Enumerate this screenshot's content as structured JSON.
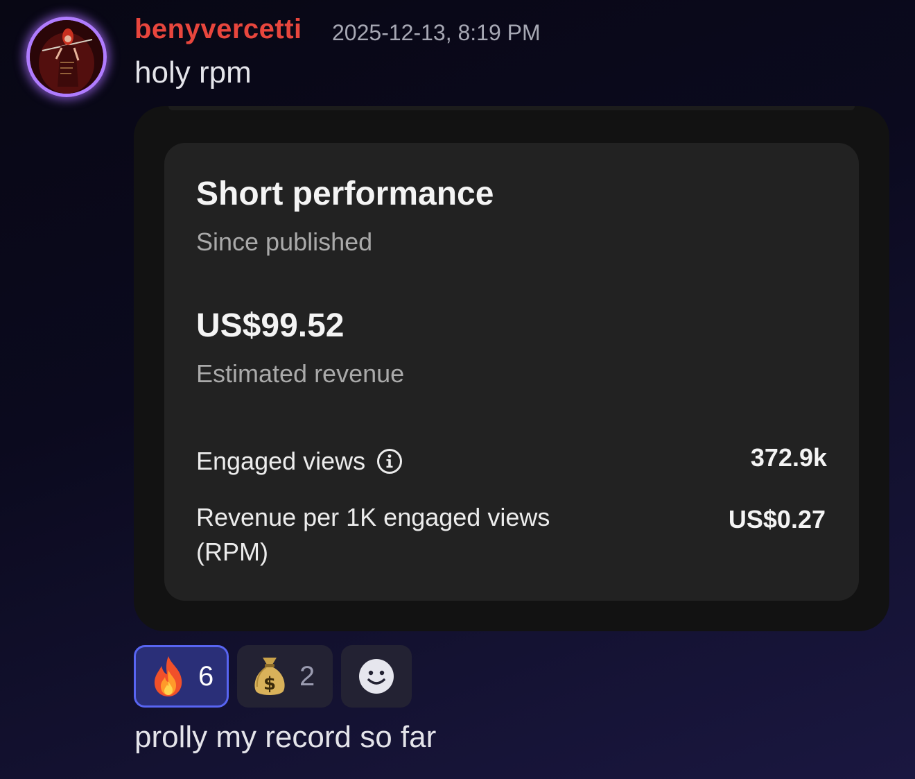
{
  "message": {
    "author": "benyvercetti",
    "timestamp": "2025-12-13, 8:19 PM",
    "text": "holy rpm",
    "author_color": "#e8463d",
    "avatar_icon": "user-avatar"
  },
  "attachment": {
    "card": {
      "title": "Short performance",
      "subtitle": "Since published",
      "revenue": {
        "value": "US$99.52",
        "label": "Estimated revenue"
      },
      "stats": [
        {
          "label": "Engaged views",
          "value": "372.9k",
          "icon": "info-icon"
        },
        {
          "label": "Revenue per 1K engaged views (RPM)",
          "value": "US$0.27"
        }
      ]
    }
  },
  "reactions": [
    {
      "emoji": "fire-emoji",
      "count": "6",
      "active": true
    },
    {
      "emoji": "money-bag-emoji",
      "count": "2",
      "active": false
    }
  ],
  "add_reaction_icon": "smiley-icon",
  "followup_message": {
    "text": "prolly my record so far"
  },
  "colors": {
    "reaction_active_border": "#5865f2",
    "card_background": "#222222"
  }
}
